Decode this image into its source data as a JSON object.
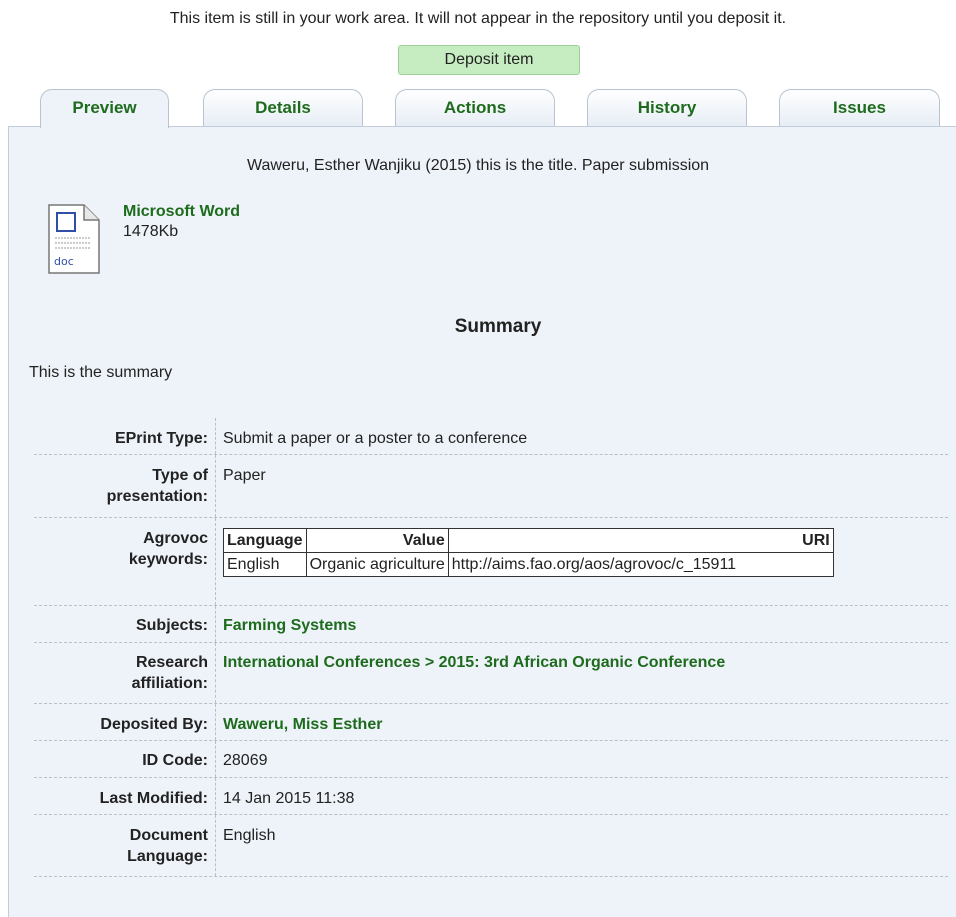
{
  "notice": "This item is still in your work area. It will not appear in the repository until you deposit it.",
  "deposit_button": "Deposit item",
  "tabs": [
    {
      "label": "Preview"
    },
    {
      "label": "Details"
    },
    {
      "label": "Actions"
    },
    {
      "label": "History"
    },
    {
      "label": "Issues"
    }
  ],
  "citation": "Waweru, Esther Wanjiku (2015) this is the title. Paper submission",
  "document": {
    "icon_label": "doc",
    "format": "Microsoft Word",
    "size": "1478Kb"
  },
  "summary": {
    "heading": "Summary",
    "text": "This is the summary"
  },
  "fields": {
    "eprint_type": {
      "label": "EPrint Type:",
      "value": "Submit a paper or a poster to a conference"
    },
    "presentation": {
      "label1": "Type of",
      "label2": "presentation:",
      "value": "Paper"
    },
    "agrovoc": {
      "label1": "Agrovoc",
      "label2": "keywords:",
      "headers": [
        "Language",
        "Value",
        "URI"
      ],
      "rows": [
        [
          "English",
          "Organic agriculture",
          "http://aims.fao.org/aos/agrovoc/c_15911"
        ]
      ]
    },
    "subjects": {
      "label": "Subjects:",
      "value": "Farming Systems"
    },
    "research": {
      "label1": "Research",
      "label2": "affiliation:",
      "value": "International Conferences > 2015: 3rd African Organic Conference"
    },
    "deposited_by": {
      "label": "Deposited By:",
      "value": "Waweru, Miss Esther"
    },
    "id_code": {
      "label": "ID Code:",
      "value": "28069"
    },
    "last_modified": {
      "label": "Last Modified:",
      "value": "14 Jan 2015 11:38"
    },
    "doc_language": {
      "label1": "Document",
      "label2": "Language:",
      "value": "English"
    }
  },
  "colors": {
    "link": "#1e6b1e",
    "panel_bg": "#eef3f9",
    "deposit_bg": "#c6ecc2"
  }
}
